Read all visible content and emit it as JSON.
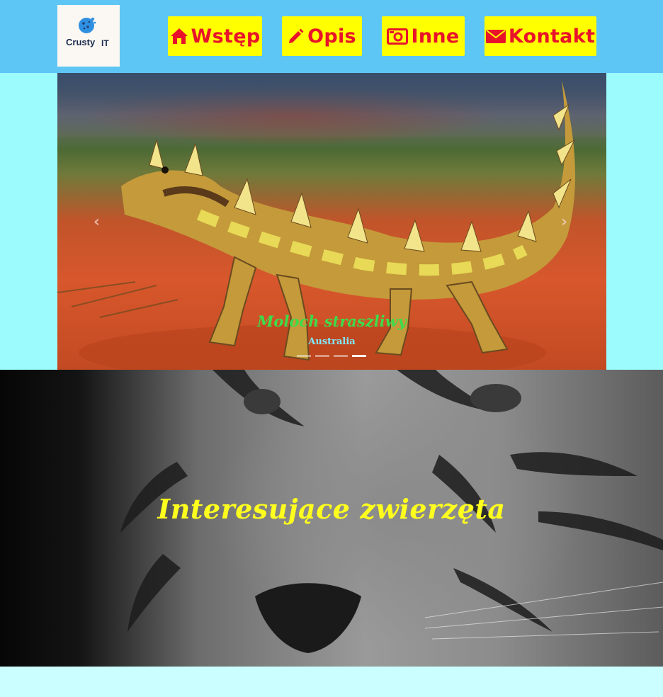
{
  "header": {
    "logo": {
      "brand": "Crusty",
      "suffix": "IT"
    },
    "nav": [
      {
        "label": "Wstęp",
        "icon": "home-icon"
      },
      {
        "label": "Opis",
        "icon": "pencil-icon"
      },
      {
        "label": "Inne",
        "icon": "camera-icon"
      },
      {
        "label": "Kontakt",
        "icon": "envelope-icon"
      }
    ]
  },
  "carousel": {
    "slide_title": "Moloch straszliwy",
    "slide_subtitle": "Australia",
    "indicator_count": 4,
    "active_index": 3
  },
  "hero": {
    "title": "Interesujące zwierzęta"
  },
  "colors": {
    "header_bg": "#5ec6f4",
    "nav_bg": "#ffff00",
    "nav_text": "#e8132a",
    "page_bg": "#cbffff",
    "slider_bg": "#9cfcfd",
    "caption_title": "#3ddc4a",
    "caption_subtitle": "#7fe9ff",
    "hero_title": "#ffff1e"
  }
}
